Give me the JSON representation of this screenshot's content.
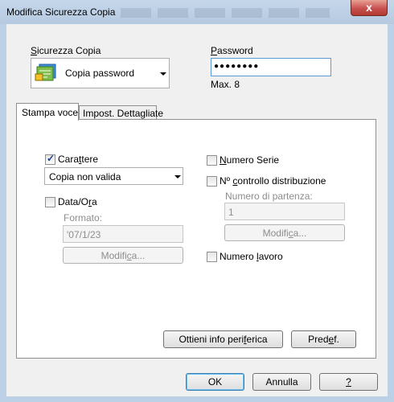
{
  "window": {
    "title": "Modifica Sicurezza Copia",
    "close_label": "x"
  },
  "security": {
    "label_prefix": "",
    "label_accel": "S",
    "label_rest": "icurezza Copia",
    "selected": "Copia password"
  },
  "password": {
    "label_accel": "P",
    "label_rest": "assword",
    "value": "●●●●●●●●",
    "max_text": "Max. 8"
  },
  "tabs": [
    {
      "label": "Stampa voce",
      "active": true
    },
    {
      "label": "Impost. Dettagliate",
      "active": false
    }
  ],
  "left_group": {
    "character": {
      "checked": true,
      "label_pre": "Cara",
      "label_accel": "t",
      "label_post": "tere"
    },
    "character_select": "Copia non valida",
    "date": {
      "checked": false,
      "label_pre": "Data/O",
      "label_accel": "r",
      "label_post": "a"
    },
    "format_label": "Formato:",
    "format_value": "'07/1/23",
    "modify_pre": "Modifi",
    "modify_accel": "c",
    "modify_post": "a..."
  },
  "right_group": {
    "serial": {
      "checked": false,
      "label_pre": "",
      "label_accel": "N",
      "label_post": "umero Serie"
    },
    "distribution": {
      "checked": false,
      "label_pre": "Nº ",
      "label_accel": "c",
      "label_post": "ontrollo distribuzione"
    },
    "start_label": "Numero di partenza:",
    "start_value": "1",
    "modify_pre": "Modifi",
    "modify_accel": "c",
    "modify_post": "a...",
    "job": {
      "checked": false,
      "label_pre": "Numero ",
      "label_accel": "l",
      "label_post": "avoro"
    }
  },
  "panel_buttons": {
    "device_pre": "Ottieni info peri",
    "device_accel": "f",
    "device_post": "erica",
    "default_pre": "Pred",
    "default_accel": "e",
    "default_post": "f."
  },
  "footer": {
    "ok": "OK",
    "cancel": "Annulla",
    "help": "?"
  }
}
